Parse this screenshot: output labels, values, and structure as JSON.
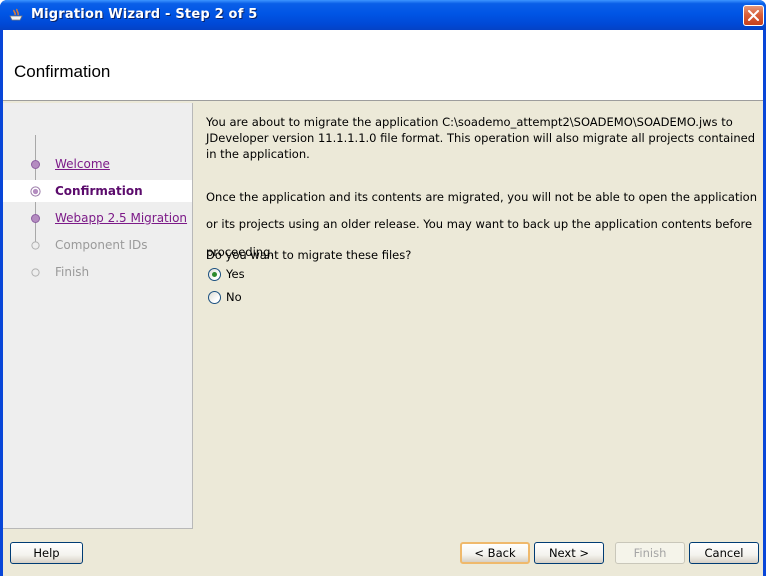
{
  "window": {
    "title": "Migration Wizard - Step 2 of 5"
  },
  "header": {
    "title": "Confirmation"
  },
  "nav": {
    "items": [
      {
        "label": "Welcome",
        "state": "link"
      },
      {
        "label": "Confirmation",
        "state": "current"
      },
      {
        "label": "Webapp 2.5 Migration",
        "state": "link"
      },
      {
        "label": "Component IDs",
        "state": "disabled"
      },
      {
        "label": "Finish",
        "state": "disabled"
      }
    ]
  },
  "content": {
    "para1_line1": "You are about to migrate the application C:\\soademo_attempt2\\SOADEMO\\SOADEMO.jws to",
    "para1_line2": "JDeveloper version 11.1.1.1.0 file format. This operation will also migrate all projects contained",
    "para1_line3": "in the application.",
    "para2_line1": "Once the application and its contents are migrated, you will not be able to open the application",
    "para2_line2": "or its projects using an older release. You may want to back up the application contents before",
    "para2_line3": "proceeding.",
    "question": "Do you want to migrate these files?",
    "options": [
      {
        "label": "Yes",
        "selected": true
      },
      {
        "label": "No",
        "selected": false
      }
    ]
  },
  "buttons": {
    "help": "Help",
    "back": "< Back",
    "next": "Next >",
    "finish": "Finish",
    "cancel": "Cancel"
  },
  "colors": {
    "titlebar": "#0055e5",
    "link": "#7c1a88",
    "current": "#5b0b6c",
    "dialog_bg": "#ece9d8",
    "close": "#d9603a"
  }
}
